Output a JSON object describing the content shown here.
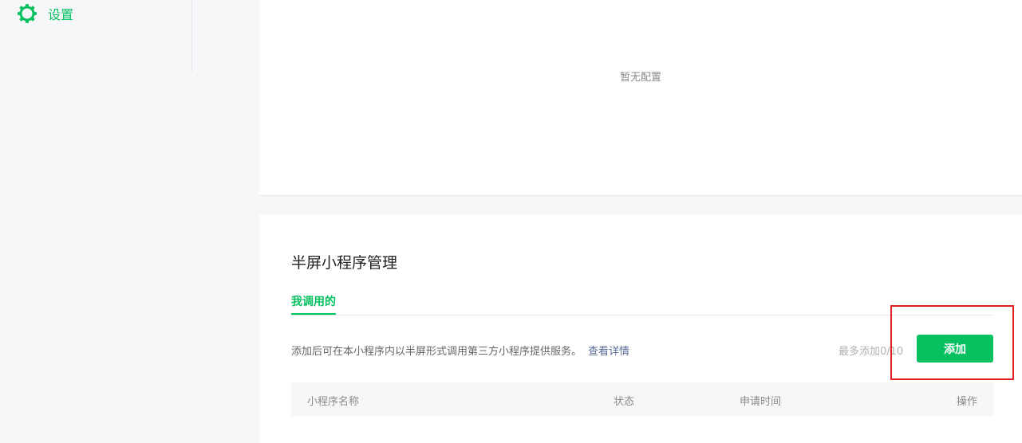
{
  "sidebar": {
    "items": [
      {
        "label": "设置",
        "icon": "gear-icon",
        "active": true
      }
    ]
  },
  "top_card": {
    "empty_text": "暂无配置"
  },
  "main_card": {
    "title": "半屏小程序管理",
    "tabs": [
      {
        "label": "我调用的",
        "active": true
      }
    ],
    "description": "添加后可在本小程序内以半屏形式调用第三方小程序提供服务。",
    "details_link": "查看详情",
    "count_text": "最多添加0/10",
    "add_button": "添加",
    "table": {
      "columns": [
        "小程序名称",
        "状态",
        "申请时间",
        "操作"
      ],
      "rows": []
    }
  },
  "colors": {
    "accent": "#07c160",
    "link": "#576b95",
    "highlight": "#e02020"
  }
}
